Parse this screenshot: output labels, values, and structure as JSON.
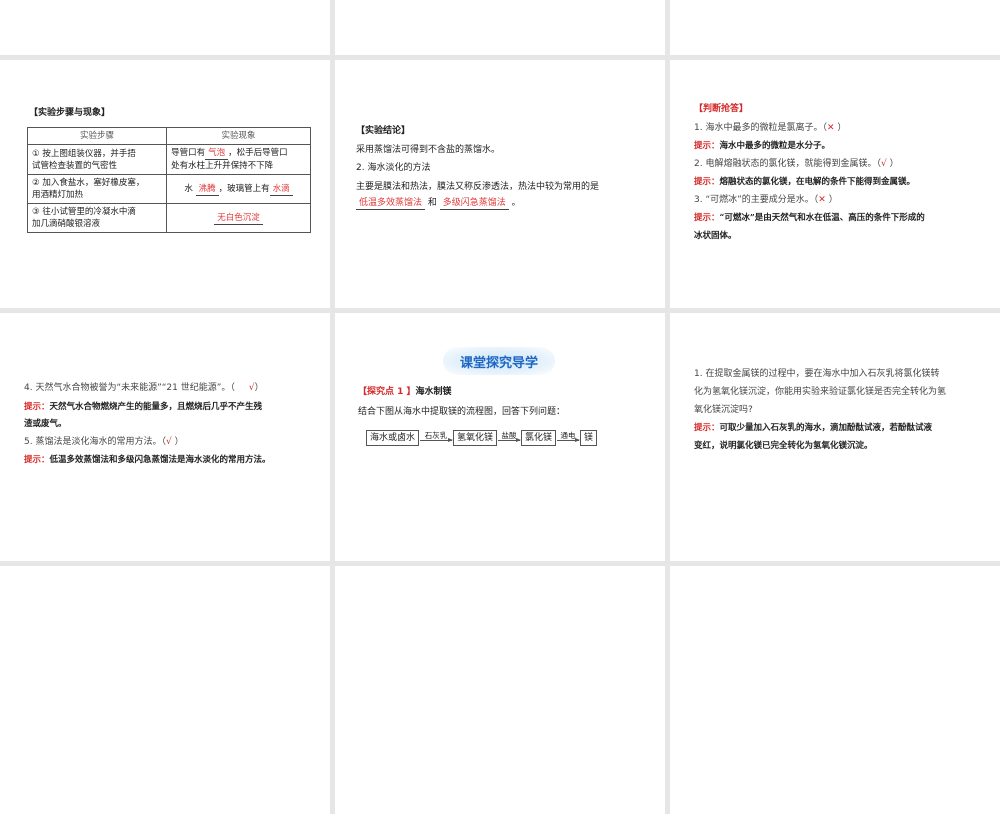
{
  "slide_exp": {
    "title": "【实验步骤与现象】",
    "head": [
      "实验步骤",
      "实验现象"
    ],
    "rows": [
      {
        "step1": "① 按上图组装仪器，并手捂",
        "step2": "试管检查装置的气密性",
        "p_pre": "导管口有",
        "ans1": "气泡",
        "p_mid": "，松手后导管口",
        "p_post": "处有水柱上升并保持不下降"
      },
      {
        "step1": "② 加入食盐水，塞好橡皮塞，",
        "step2": "用酒精灯加热",
        "p_pre": "水",
        "ans1": "沸腾",
        "p_mid": "，玻璃管上有",
        "ans2": "水滴"
      },
      {
        "step1": "③ 往小试管里的冷凝水中滴",
        "step2": "加几滴硝酸银溶液",
        "ans1": "无白色沉淀"
      }
    ]
  },
  "slide_conc": {
    "title": "【实验结论】",
    "l1": "采用蒸馏法可得到不含盐的蒸馏水。",
    "l2": "2. 海水淡化的方法",
    "l3": "主要是膜法和热法，膜法又称反渗透法，热法中较为常用的是",
    "a1": "低温多效蒸馏法",
    "and": "和",
    "a2": "多级闪急蒸馏法",
    "end": "。"
  },
  "slide_judge": {
    "title": "【判断抢答】",
    "tip": "提示：",
    "items": [
      {
        "q": "1. 海水中最多的微粒是氯离子。（",
        "mark": "✕",
        "close": "  ）",
        "hint": "海水中最多的微粒是水分子。"
      },
      {
        "q": "2. 电解熔融状态的氯化镁，就能得到金属镁。（",
        "mark": "√",
        "close": "  ）",
        "hint": "熔融状态的氯化镁，在电解的条件下能得到金属镁。"
      },
      {
        "q": "3. “可燃冰”的主要成分是水。（",
        "mark": "✕",
        "close": "  ）",
        "hint": "“可燃冰”是由天然气和水在低温、高压的条件下形成的",
        "hint2": "冰状固体。"
      }
    ]
  },
  "slide_judge2": {
    "tip": "提示：",
    "items": [
      {
        "q": "4. 天然气水合物被誉为“未来能源”“21 世纪能源”。（",
        "mark": "√",
        "close": "）",
        "hint": "天然气水合物燃烧产生的能量多，且燃烧后几乎不产生残",
        "hint2": "渣或废气。"
      },
      {
        "q": "5. 蒸馏法是淡化海水的常用方法。（",
        "mark": "√",
        "close": "  ）",
        "hint": "低温多效蒸馏法和多级闪急蒸馏法是海水淡化的常用方法。"
      }
    ]
  },
  "slide_explore": {
    "banner": "课堂探究导学",
    "tag": "【探究点 1 】",
    "topic": "海水制镁",
    "intro": "结合下图从海水中提取镁的流程图，回答下列问题：",
    "flow": {
      "n1": "海水或卤水",
      "a1": "石灰乳",
      "n2": "氢氧化镁",
      "a2": "盐酸",
      "n3": "氯化镁",
      "a3": "通电",
      "n4": "镁"
    }
  },
  "slide_q": {
    "l1": "1. 在提取金属镁的过程中，要在海水中加入石灰乳将氯化镁转",
    "l2": "化为氢氧化镁沉淀，你能用实验来验证氯化镁是否完全转化为氢",
    "l3": "氧化镁沉淀吗?",
    "tip": "提示：",
    "h1": "可取少量加入石灰乳的海水，滴加酚酞试液，若酚酞试液",
    "h2": "变红，说明氯化镁已完全转化为氢氧化镁沉淀。"
  }
}
